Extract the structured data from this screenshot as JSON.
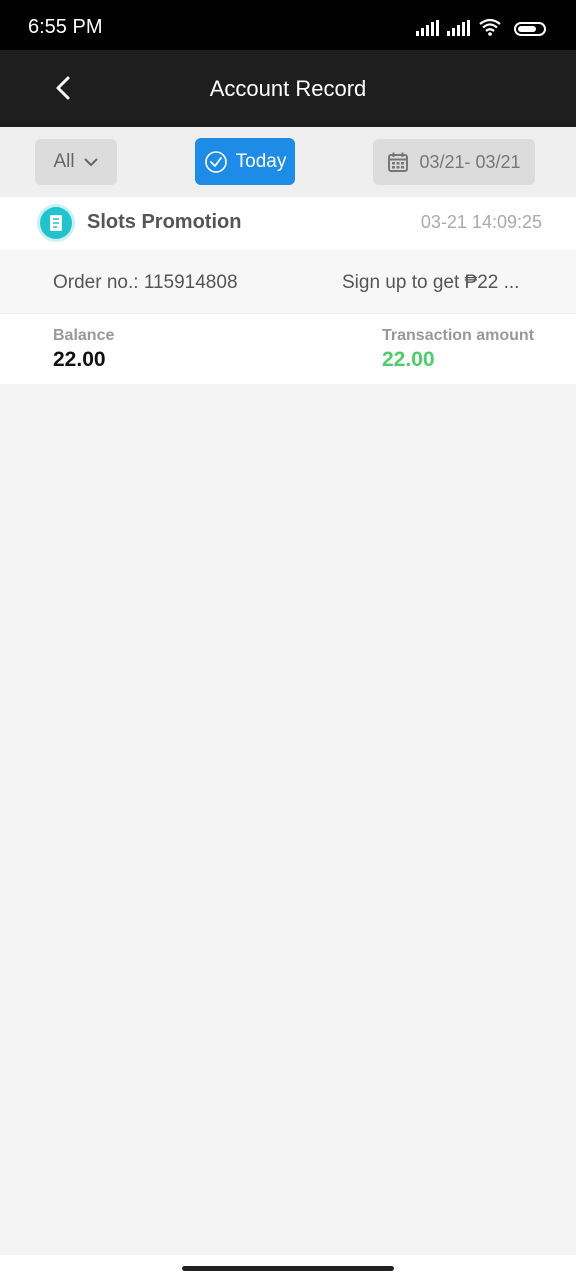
{
  "status_bar": {
    "time": "6:55 PM"
  },
  "header": {
    "title": "Account Record"
  },
  "filters": {
    "type_label": "All",
    "today_label": "Today",
    "date_range": "03/21- 03/21"
  },
  "record": {
    "title": "Slots Promotion",
    "timestamp": "03-21 14:09:25",
    "order_no": "Order no.: 115914808",
    "description": "Sign up to get ₱22  ...",
    "balance_label": "Balance",
    "balance_value": "22.00",
    "transaction_label": "Transaction amount",
    "transaction_value": "22.00"
  },
  "colors": {
    "accent": "#1e8be6",
    "positive": "#4ccd6a",
    "header_bg": "#1e1e1e"
  },
  "icons": [
    "back-arrow-icon",
    "chevron-down-icon",
    "check-circle-icon",
    "calendar-icon",
    "document-icon"
  ]
}
